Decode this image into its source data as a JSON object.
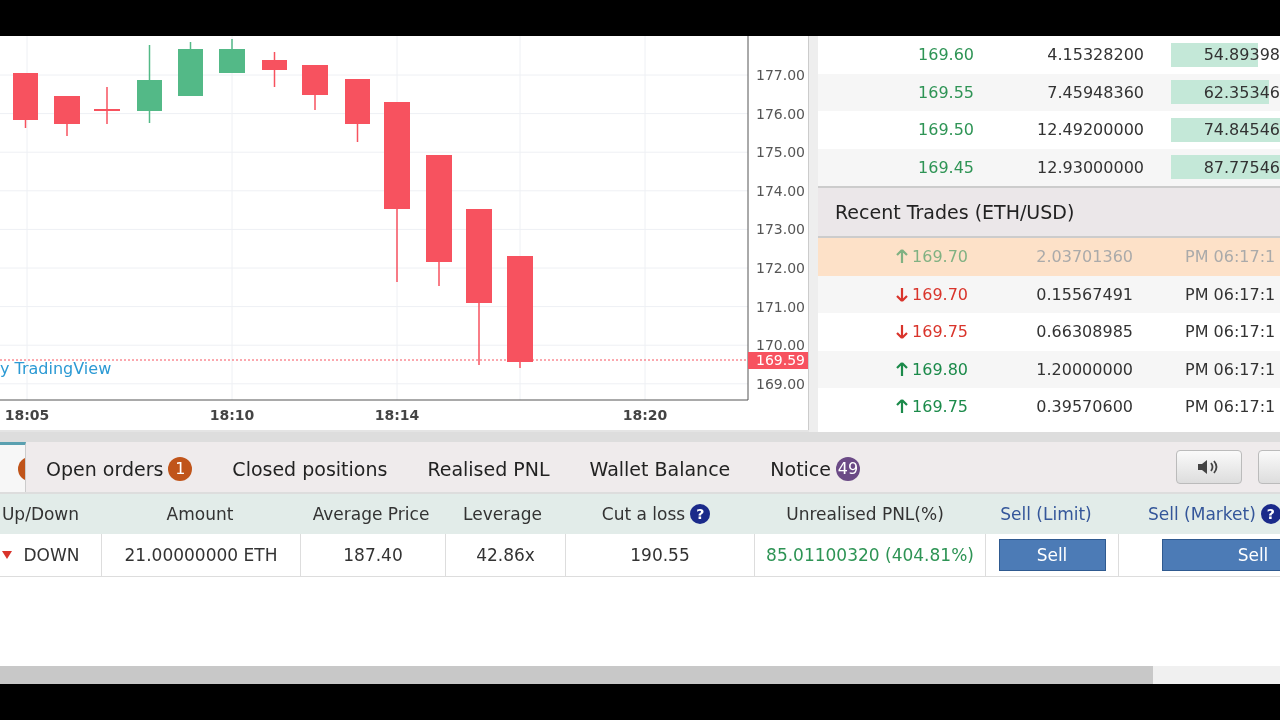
{
  "chart": {
    "y_labels": [
      "177.00",
      "176.00",
      "175.00",
      "174.00",
      "173.00",
      "172.00",
      "171.00",
      "170.00",
      "169.00"
    ],
    "x_labels": [
      "18:05",
      "18:10",
      "18:14",
      "18:20"
    ],
    "last_price": "169.59",
    "attribution": "y TradingView"
  },
  "order_book": {
    "rows": [
      {
        "price": "169.60",
        "amount": "4.15328200",
        "total": "54.89398",
        "level": 0.8
      },
      {
        "price": "169.55",
        "amount": "7.45948360",
        "total": "62.35346",
        "level": 0.9
      },
      {
        "price": "169.50",
        "amount": "12.49200000",
        "total": "74.84546",
        "level": 1
      },
      {
        "price": "169.45",
        "amount": "12.93000000",
        "total": "87.77546",
        "level": 1
      }
    ]
  },
  "recent_trades": {
    "title": "Recent Trades (ETH/USD)",
    "rows": [
      {
        "rising": true,
        "price": "169.70",
        "amount": "2.03701360",
        "time": "PM 06:17:1",
        "highlighted": true
      },
      {
        "rising": false,
        "price": "169.70",
        "amount": "0.15567491",
        "time": "PM 06:17:1",
        "highlighted": false
      },
      {
        "rising": false,
        "price": "169.75",
        "amount": "0.66308985",
        "time": "PM 06:17:1",
        "highlighted": false
      },
      {
        "rising": true,
        "price": "169.80",
        "amount": "1.20000000",
        "time": "PM 06:17:1",
        "highlighted": false
      },
      {
        "rising": true,
        "price": "169.75",
        "amount": "0.39570600",
        "time": "PM 06:17:1",
        "highlighted": false
      }
    ]
  },
  "tabs": [
    {
      "selected": true,
      "color": "#c0541a"
    },
    {
      "label": "Open orders",
      "badge": "1",
      "color": "#c0541a",
      "selected": false
    },
    {
      "label": "Closed positions",
      "selected": false
    },
    {
      "label": "Realised PNL",
      "selected": false
    },
    {
      "label": "Wallet Balance",
      "selected": false
    },
    {
      "label": "Notice",
      "badge": "49",
      "color": "#6b4a86",
      "selected": false
    }
  ],
  "table": {
    "columns": [
      {
        "label": "Up/Down",
        "kind": "plain"
      },
      {
        "label": "Amount",
        "kind": "plain"
      },
      {
        "label": "Average Price",
        "kind": "plain"
      },
      {
        "label": "Leverage",
        "kind": "plain"
      },
      {
        "label": "Cut a loss",
        "help": "?",
        "kind": "plain"
      },
      {
        "label": "Unrealised PNL(%)",
        "kind": "plain"
      },
      {
        "label": "Sell (Limit)",
        "kind": "action"
      },
      {
        "label": "Sell (Market)",
        "help": "?",
        "kind": "action"
      }
    ],
    "rows": [
      [
        {
          "kind": "direction",
          "rising": false,
          "text": "DOWN"
        },
        {
          "kind": "text",
          "text": "21.00000000 ETH"
        },
        {
          "kind": "text",
          "text": "187.40"
        },
        {
          "kind": "text",
          "text": "42.86x"
        },
        {
          "kind": "text",
          "text": "190.55"
        },
        {
          "kind": "profit",
          "text": "85.01100320 (404.81%)"
        },
        {
          "kind": "button",
          "text": "Sell"
        },
        {
          "kind": "button",
          "text": "Sell"
        }
      ]
    ]
  }
}
